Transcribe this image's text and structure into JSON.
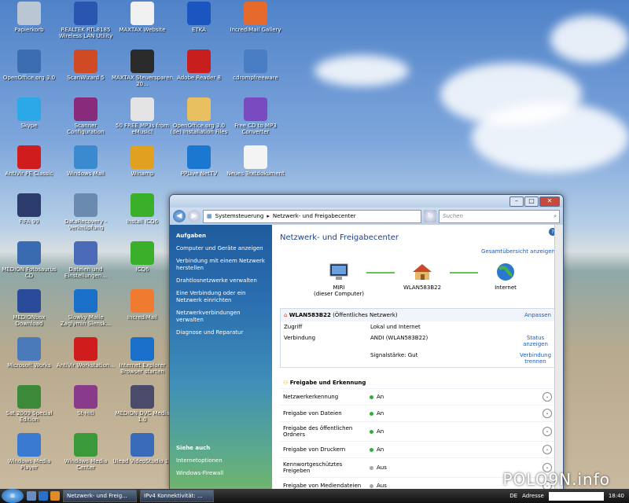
{
  "desktop": {
    "icons": [
      {
        "label": "Papierkorb",
        "icon": "trash-icon",
        "color": "#b9c7d5"
      },
      {
        "label": "REALTEK RTL8185 Wireless LAN Utility",
        "icon": "wireless-icon",
        "color": "#2a56b0"
      },
      {
        "label": "MAXTAX Website",
        "icon": "document-icon",
        "color": "#f0f0f0"
      },
      {
        "label": "ETKA",
        "icon": "globe-icon",
        "color": "#1b55c0"
      },
      {
        "label": "IncrediMail Gallery",
        "icon": "gallery-icon",
        "color": "#e56a2c"
      },
      {
        "label": "OpenOffice.org 3.0",
        "icon": "openoffice-icon",
        "color": "#3b6db0"
      },
      {
        "label": "ScanWizard 5",
        "icon": "scanner-icon",
        "color": "#d04a24"
      },
      {
        "label": "MAXTAX Steuersparen 20...",
        "icon": "maxtax-icon",
        "color": "#2a2a2a"
      },
      {
        "label": "Adobe Reader 8",
        "icon": "pdf-icon",
        "color": "#c81e1e"
      },
      {
        "label": "cdrompfreeware",
        "icon": "installer-icon",
        "color": "#4a7ec4"
      },
      {
        "label": "Skype",
        "icon": "skype-icon",
        "color": "#2aa8e8"
      },
      {
        "label": "Scanner Configuration",
        "icon": "scanner-config-icon",
        "color": "#8a2a7a"
      },
      {
        "label": "50 FREE MP3s from eMusic!",
        "icon": "music-dots-icon",
        "color": "#e4e4e4"
      },
      {
        "label": "OpenOffice.org 3.0 (de) Installation Files",
        "icon": "folder-icon",
        "color": "#e8c060"
      },
      {
        "label": "Free CD to MP3 Converter",
        "icon": "cd-icon",
        "color": "#7a4ac0"
      },
      {
        "label": "AntiVir PE Classic",
        "icon": "antivir-icon",
        "color": "#d01c1c"
      },
      {
        "label": "Windows Mail",
        "icon": "mail-icon",
        "color": "#3a8ad0"
      },
      {
        "label": "Winamp",
        "icon": "winamp-icon",
        "color": "#e0a020"
      },
      {
        "label": "PPLive NetTV",
        "icon": "pplive-icon",
        "color": "#1a78d0"
      },
      {
        "label": "Neues Textdokument",
        "icon": "text-document-icon",
        "color": "#f4f4f4"
      },
      {
        "label": "FIFA 99",
        "icon": "fifa-icon",
        "color": "#2b3b6b"
      },
      {
        "label": "DataRecovery - Verknüpfung",
        "icon": "data-recovery-icon",
        "color": "#6a8ab0"
      },
      {
        "label": "Install ICQ6",
        "icon": "icq-icon",
        "color": "#3ab02a"
      },
      {
        "label": "MEDION Fotosaurus CD",
        "icon": "medion-cd-icon",
        "color": "#3a6ab0"
      },
      {
        "label": "Dateien und Einstellungen...",
        "icon": "transfer-icon",
        "color": "#4a6ab8"
      },
      {
        "label": "ICQ6",
        "icon": "icq6-icon",
        "color": "#3ab02a"
      },
      {
        "label": "MEDIONbox Download",
        "icon": "medionbox-icon",
        "color": "#2a4a9a"
      },
      {
        "label": "Slowky Maile Zaglymin Slensk...",
        "icon": "ie-shortcut-icon",
        "color": "#1a70c8"
      },
      {
        "label": "IncrediMail",
        "icon": "incredimail-icon",
        "color": "#f07a30"
      },
      {
        "label": "Microsoft Works",
        "icon": "works-icon",
        "color": "#4a7aba"
      },
      {
        "label": "AntiVir Workstation...",
        "icon": "antivir-ws-icon",
        "color": "#d01c1c"
      },
      {
        "label": "Internet Explorer Browser starten",
        "icon": "internet-explorer-icon",
        "color": "#1a70c8"
      },
      {
        "label": "Sat 2009 Special Edition",
        "icon": "sat-icon",
        "color": "#3a8a3a"
      },
      {
        "label": "St-Hiti",
        "icon": "st-icon",
        "color": "#8a3a8a"
      },
      {
        "label": "MEDION DVC Media 1.0",
        "icon": "camcorder-icon",
        "color": "#4a4a6a"
      },
      {
        "label": "Windows Media Player",
        "icon": "media-player-icon",
        "color": "#3a7ad0"
      },
      {
        "label": "Windows Media Center",
        "icon": "media-center-icon",
        "color": "#3a9a3a"
      },
      {
        "label": "Ulead VideoStudio 11",
        "icon": "videostudio-icon",
        "color": "#3a6aba"
      }
    ]
  },
  "window": {
    "breadcrumb": [
      "Systemsteuerung",
      "Netzwerk- und Freigabecenter"
    ],
    "search_placeholder": "Suchen",
    "left": {
      "heading": "Aufgaben",
      "links": [
        "Computer und Geräte anzeigen",
        "Verbindung mit einem Netzwerk herstellen",
        "Drahtlosnetzwerke verwalten",
        "Eine Verbindung oder ein Netzwerk einrichten",
        "Netzwerkverbindungen verwalten",
        "Diagnose und Reparatur"
      ],
      "see_also_heading": "Siehe auch",
      "see_also": [
        "Internetoptionen",
        "Windows-Firewall"
      ]
    },
    "title": "Netzwerk- und Freigabecenter",
    "full_map_link": "Gesamtübersicht anzeigen",
    "map": {
      "computer_name": "MIRI",
      "computer_sub": "(dieser Computer)",
      "network": "WLAN583B22",
      "internet": "Internet"
    },
    "network": {
      "name": "WLAN583B22",
      "type": "(Öffentliches Netzwerk)",
      "customize": "Anpassen",
      "rows": [
        {
          "k": "Zugriff",
          "v": "Lokal und Internet",
          "a": ""
        },
        {
          "k": "Verbindung",
          "v": "ANDI (WLAN583B22)",
          "a": "Status anzeigen"
        },
        {
          "k": "",
          "v": "Signalstärke: Gut",
          "a": "Verbindung trennen"
        }
      ]
    },
    "sharing": {
      "heading": "Freigabe und Erkennung",
      "rows": [
        {
          "k": "Netzwerkerkennung",
          "v": "An",
          "on": true
        },
        {
          "k": "Freigabe von Dateien",
          "v": "An",
          "on": true
        },
        {
          "k": "Freigabe des öffentlichen Ordners",
          "v": "An",
          "on": true
        },
        {
          "k": "Freigabe von Druckern",
          "v": "An",
          "on": true
        },
        {
          "k": "Kennwortgeschütztes Freigeben",
          "v": "Aus",
          "on": false
        },
        {
          "k": "Freigabe von Mediendateien",
          "v": "Aus",
          "on": false
        }
      ]
    }
  },
  "taskbar": {
    "buttons": [
      "Netzwerk- und Freig...",
      "IPv4 Konnektivität: ..."
    ],
    "lang": "DE",
    "address_label": "Adresse",
    "clock": "18:40"
  },
  "watermark": "POLO9N.info"
}
